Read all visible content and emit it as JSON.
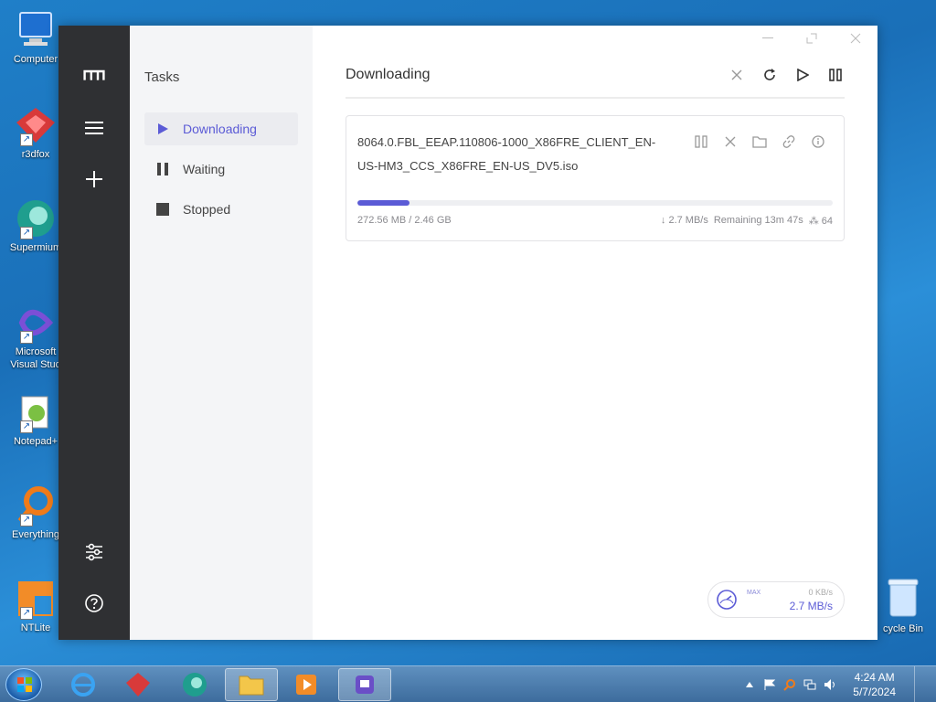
{
  "desktop": {
    "icons": [
      {
        "label": "Computer",
        "icon": "computer-icon"
      },
      {
        "label": "r3dfox",
        "icon": "r3dfox-icon"
      },
      {
        "label": "Supermium",
        "icon": "supermium-icon"
      },
      {
        "label": "Microsoft Visual Stud",
        "icon": "visual-studio-icon"
      },
      {
        "label": "Notepad+",
        "icon": "notepad-plus-icon"
      },
      {
        "label": "Everything",
        "icon": "everything-icon"
      },
      {
        "label": "NTLite",
        "icon": "ntlite-icon"
      }
    ],
    "recycle_bin": "cycle Bin"
  },
  "sidebar": {
    "title": "Tasks",
    "items": [
      {
        "label": "Downloading",
        "icon": "play-icon",
        "active": true
      },
      {
        "label": "Waiting",
        "icon": "pause-icon",
        "active": false
      },
      {
        "label": "Stopped",
        "icon": "stop-icon",
        "active": false
      }
    ]
  },
  "main": {
    "title": "Downloading",
    "task": {
      "name": "8064.0.FBL_EEAP.110806-1000_X86FRE_CLIENT_EN-US-HM3_CCS_X86FRE_EN-US_DV5.iso",
      "progress_percent": 11,
      "size_text": "272.56 MB / 2.46 GB",
      "speed_text": "↓ 2.7 MB/s",
      "remaining_text": "Remaining 13m 47s",
      "connections_text": "⁂ 64"
    },
    "speedometer": {
      "max_label": "MAX",
      "upload": "0 KB/s",
      "download": "2.7 MB/s"
    }
  },
  "taskbar": {
    "time": "4:24 AM",
    "date": "5/7/2024"
  },
  "colors": {
    "accent": "#5b5bd6",
    "rail": "#2f3033",
    "sidebar_bg": "#f4f5f7"
  }
}
